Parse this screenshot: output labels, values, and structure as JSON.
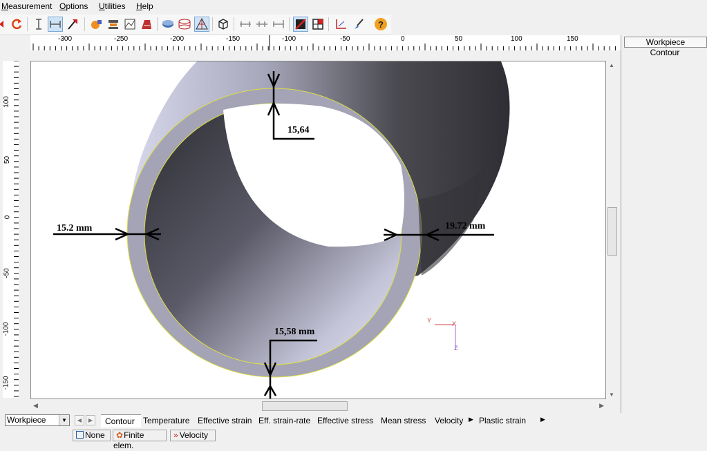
{
  "menu": [
    "Measurement",
    "Options",
    "Utilities",
    "Help"
  ],
  "toolbar": {
    "icons": [
      "move-icon",
      "rotate-icon",
      "dimension-vertical-icon",
      "dimension-horizontal-icon",
      "arrow-tool-icon",
      "object-icon-1",
      "object-icon-2",
      "object-icon-3",
      "object-icon-4",
      "disc-icon",
      "cylinder-icon",
      "mesh-triangle-icon",
      "cube-icon",
      "measure-icon-1",
      "measure-icon-2",
      "measure-icon-3",
      "toggle-icon-1",
      "toggle-icon-2",
      "axes-icon",
      "brush-icon",
      "help-icon"
    ]
  },
  "ruler": {
    "h_ticks": [
      "-300",
      "-250",
      "-200",
      "-150",
      "-100",
      "-50",
      "0",
      "50",
      "100",
      "150"
    ],
    "v_ticks": [
      "100",
      "50",
      "0",
      "-50",
      "-100",
      "-150"
    ]
  },
  "right_panel": {
    "items": [
      "Workpiece",
      "Contour"
    ],
    "selected": "Workpiece"
  },
  "measurements": {
    "top": "15,64",
    "left": "15.2 mm",
    "right": "19.72 mm",
    "bottom": "15,58 mm"
  },
  "axes": {
    "y": "Y",
    "x": "X",
    "z": "Z"
  },
  "bottom": {
    "object_select": "Workpiece",
    "tabs": [
      "Contour",
      "Temperature",
      "Effective strain",
      "Eff. strain-rate",
      "Effective stress",
      "Mean stress",
      "Velocity",
      "Plastic strain"
    ],
    "active_tab": "Contour"
  },
  "status": {
    "items": [
      "None",
      "Finite elem.",
      "Velocity"
    ]
  },
  "colors": {
    "accent": "#cfe3f7",
    "selection_yellow": "#e6e600",
    "part": "#a6a6b8"
  }
}
